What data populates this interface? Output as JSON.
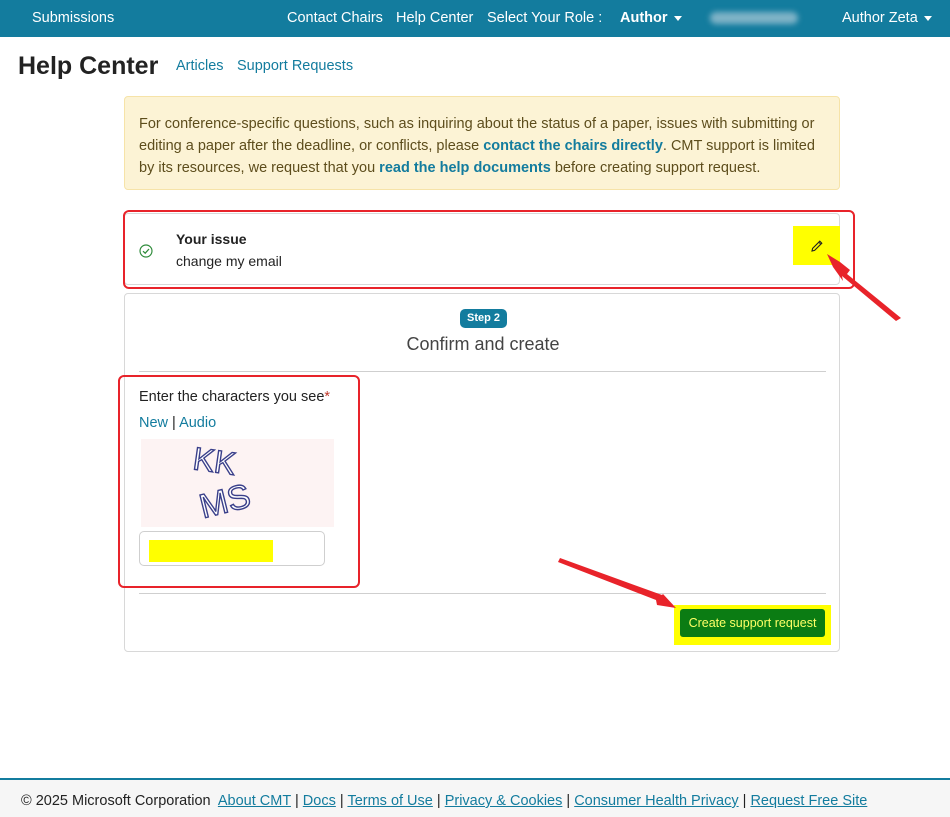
{
  "topnav": {
    "submissions": "Submissions",
    "contact_chairs": "Contact Chairs",
    "help_center": "Help Center",
    "select_role_label": "Select Your Role :",
    "role_value": "Author",
    "user_name": "Author Zeta"
  },
  "page_header": {
    "title": "Help Center",
    "links": [
      "Articles",
      "Support Requests"
    ]
  },
  "alert": {
    "text_1": "For conference-specific questions, such as inquiring about the status of a paper, issues with submitting or editing a paper after the deadline, or conflicts, please ",
    "link_1": "contact the chairs directly",
    "text_2": ". CMT support is limited by its resources, we request that you ",
    "link_2": "read the help documents",
    "text_3": " before creating support request."
  },
  "issue": {
    "label": "Your issue",
    "value": "change my email"
  },
  "step": {
    "badge": "Step 2",
    "title": "Confirm and create"
  },
  "captcha": {
    "label": "Enter the characters you see",
    "required_mark": "*",
    "new_link": "New",
    "separator": "|",
    "audio_link": "Audio",
    "image_text_line1": "KK",
    "image_text_line2": "MS",
    "input_value": ""
  },
  "submit_button": "Create support request",
  "footer": {
    "copyright": "© 2025 Microsoft Corporation",
    "links": [
      "About CMT",
      "Docs",
      "Terms of Use",
      "Privacy & Cookies",
      "Consumer Health Privacy",
      "Request Free Site"
    ],
    "separator": "|"
  },
  "colors": {
    "nav_bg": "#137c9e",
    "accent": "#137c9e",
    "highlight": "#ffff00",
    "annotation_red": "#e8232a",
    "submit_green": "#0b7c13",
    "alert_bg": "#fcf3d5"
  }
}
